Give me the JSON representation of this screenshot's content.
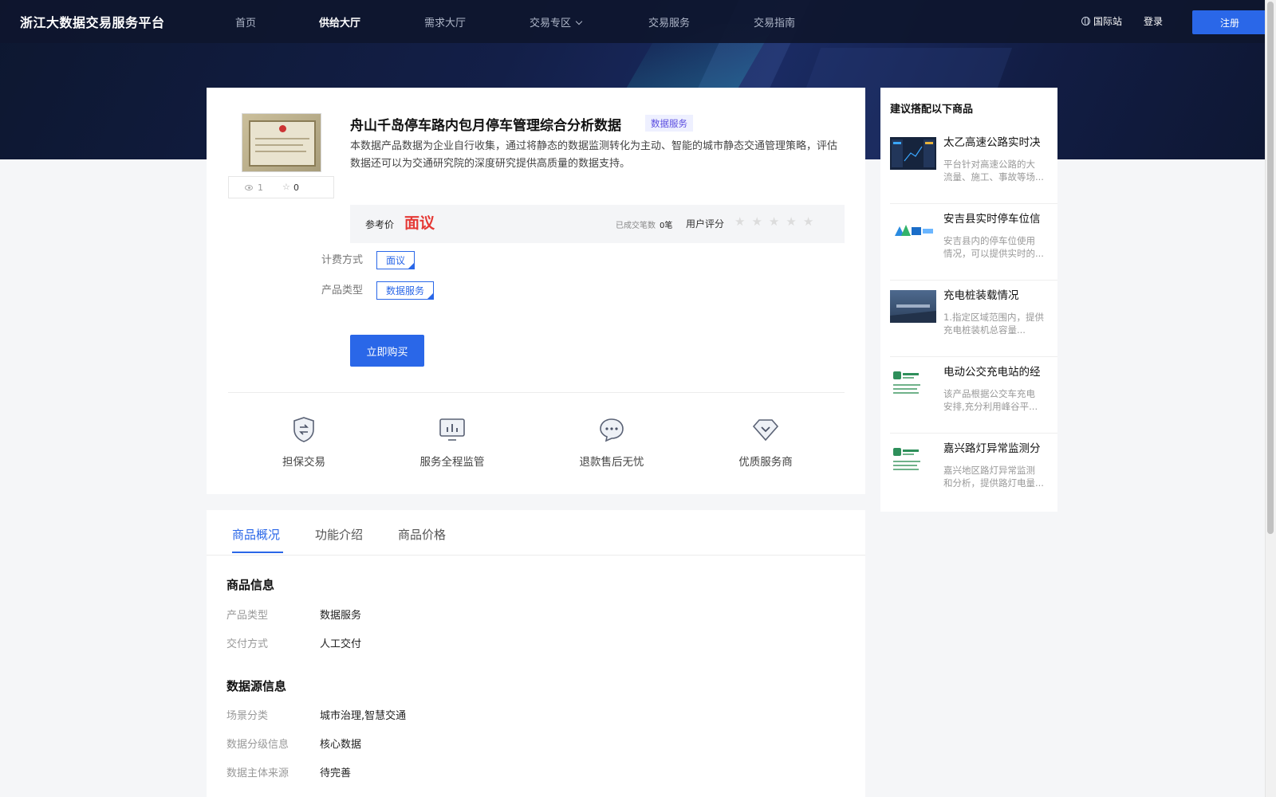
{
  "nav": {
    "logo": "浙江大数据交易服务平台",
    "items": [
      "首页",
      "供给大厅",
      "需求大厅",
      "交易专区",
      "交易服务",
      "交易指南"
    ],
    "intl": "国际站",
    "login": "登录",
    "register": "注册"
  },
  "product": {
    "views": "1",
    "favorites": "0",
    "title": "舟山千岛停车路内包月停车管理综合分析数据",
    "tag": "数据服务",
    "description": "本数据产品数据为企业自行收集，通过将静态的数据监测转化为主动、智能的城市静态交通管理策略，评估数据还可以为交通研究院的深度研究提供高质量的数据支持。",
    "price_label": "参考价",
    "price_value": "面议",
    "deals_label": "已成交笔数",
    "deals_value": "0笔",
    "rating_label": "用户评分",
    "rating": 0,
    "billing_label": "计费方式",
    "billing_value": "面议",
    "type_label": "产品类型",
    "type_value": "数据服务",
    "buy_label": "立即购买"
  },
  "features": [
    {
      "label": "担保交易",
      "icon": "shield-exchange-icon"
    },
    {
      "label": "服务全程监管",
      "icon": "monitor-chart-icon"
    },
    {
      "label": "退款售后无忧",
      "icon": "chat-bubble-icon"
    },
    {
      "label": "优质服务商",
      "icon": "diamond-badge-icon"
    }
  ],
  "tabs": [
    "商品概况",
    "功能介绍",
    "商品价格"
  ],
  "goods_info": {
    "heading": "商品信息",
    "rows": [
      {
        "k": "产品类型",
        "v": "数据服务"
      },
      {
        "k": "交付方式",
        "v": "人工交付"
      }
    ]
  },
  "source_info": {
    "heading": "数据源信息",
    "rows": [
      {
        "k": "场景分类",
        "v": "城市治理,智慧交通"
      },
      {
        "k": "数据分级信息",
        "v": "核心数据"
      },
      {
        "k": "数据主体来源",
        "v": "待完善"
      }
    ]
  },
  "sidebar": {
    "heading": "建议搭配以下商品",
    "items": [
      {
        "title": "太乙高速公路实时决",
        "desc": "平台针对高速公路的大流量、施工、事故等场..."
      },
      {
        "title": "安吉县实时停车位信",
        "desc": "安吉县内的停车位使用情况，可以提供实时的..."
      },
      {
        "title": "充电桩装载情况",
        "desc": "1.指定区域范围内，提供充电桩装机总容量..."
      },
      {
        "title": "电动公交充电站的经",
        "desc": "该产品根据公交车充电安排,充分利用峰谷平..."
      },
      {
        "title": "嘉兴路灯异常监测分",
        "desc": "嘉兴地区路灯异常监测和分析，提供路灯电量..."
      }
    ]
  }
}
